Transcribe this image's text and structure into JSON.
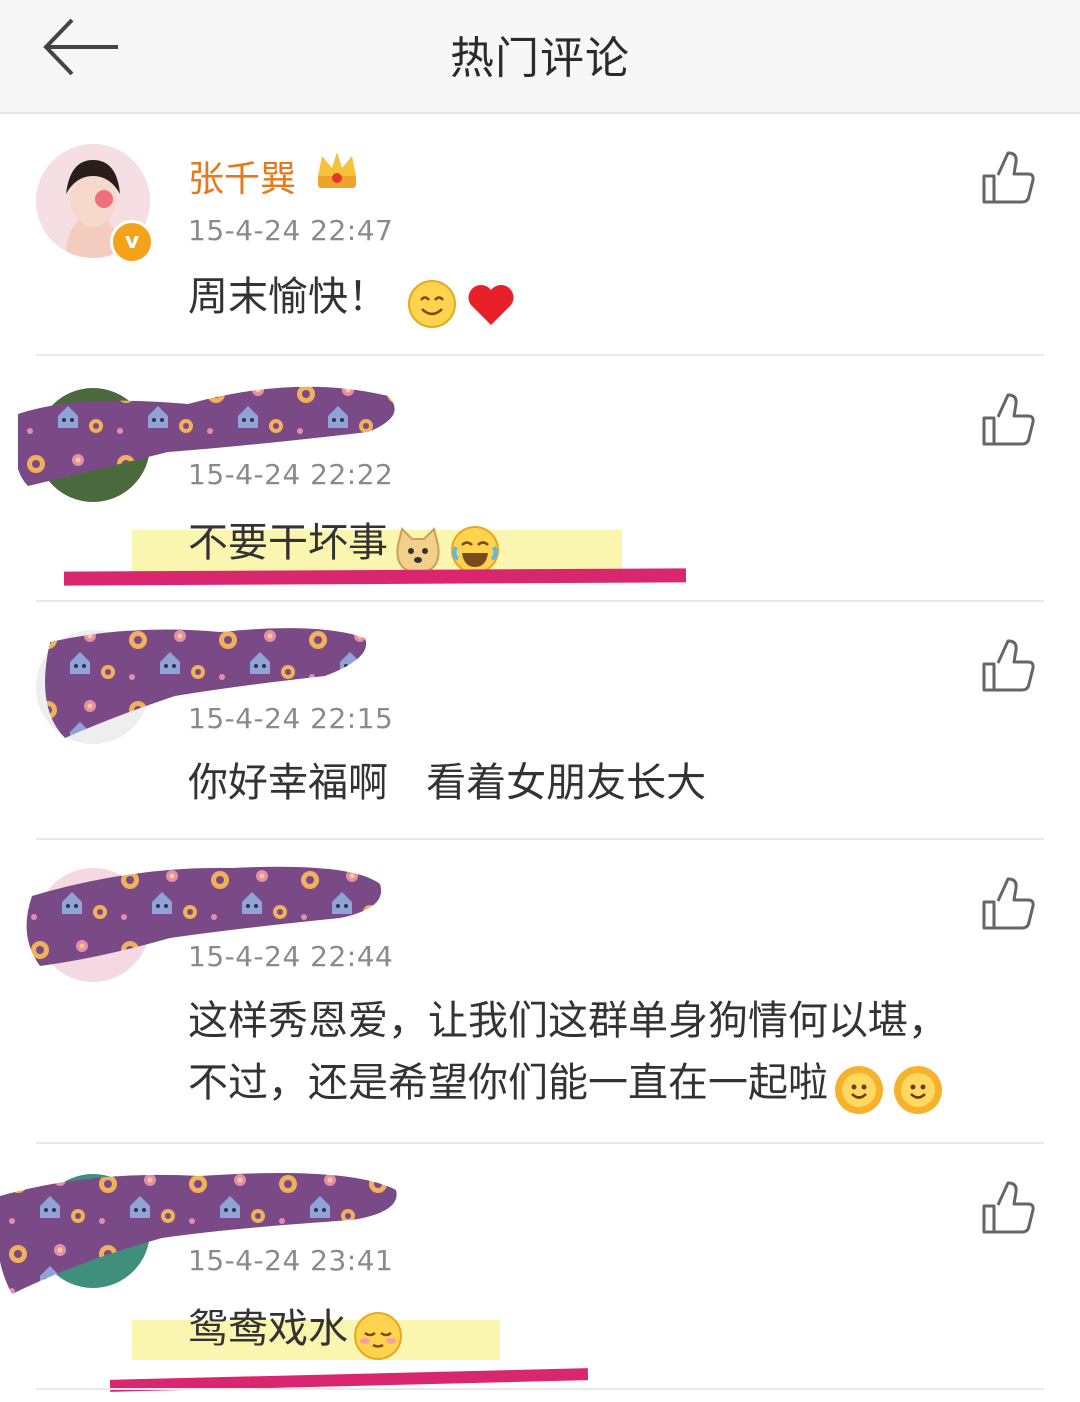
{
  "header": {
    "title": "热门评论"
  },
  "comments": [
    {
      "username": "张千巽",
      "time": "15-4-24 22:47",
      "text": "周末愉快！"
    },
    {
      "time": "15-4-24 22:22",
      "text": "不要干坏事"
    },
    {
      "time": "15-4-24 22:15",
      "text": "你好幸福啊   看着女朋友长大"
    },
    {
      "time": "15-4-24 22:44",
      "text_line1": "这样秀恩爱，让我们这群单身狗情何以堪，",
      "text_line2": "不过，还是希望你们能一直在一起啦"
    },
    {
      "time": "15-4-24 23:41",
      "text": "鸳鸯戏水"
    }
  ],
  "colors": {
    "username": "#e8791b",
    "timestamp": "#8a8a8a",
    "censor_purple": "#7a4a86",
    "highlight_yellow": "#fbf5a6",
    "underline_red": "#d9276f"
  },
  "icons": [
    "back-arrow-icon",
    "crown-icon",
    "verified-icon",
    "like-icon",
    "smile-emoji-icon",
    "heart-emoji-icon",
    "doge-emoji-icon",
    "laugh-cry-emoji-icon",
    "sun-emoji-icon",
    "shy-emoji-icon"
  ]
}
